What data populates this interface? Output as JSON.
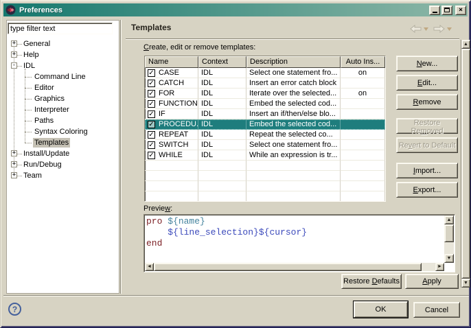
{
  "window": {
    "title": "Preferences",
    "controls": {
      "minimize": "minimize",
      "maximize": "maximize",
      "close": "close"
    }
  },
  "sidebar": {
    "filter_text": "type filter text",
    "tree": [
      {
        "label": "General",
        "level": 0,
        "expander": "+",
        "selected": false
      },
      {
        "label": "Help",
        "level": 0,
        "expander": "+",
        "selected": false
      },
      {
        "label": "IDL",
        "level": 0,
        "expander": "-",
        "selected": false
      },
      {
        "label": "Command Line",
        "level": 1,
        "expander": "",
        "selected": false
      },
      {
        "label": "Editor",
        "level": 1,
        "expander": "",
        "selected": false
      },
      {
        "label": "Graphics",
        "level": 1,
        "expander": "",
        "selected": false
      },
      {
        "label": "Interpreter",
        "level": 1,
        "expander": "",
        "selected": false
      },
      {
        "label": "Paths",
        "level": 1,
        "expander": "",
        "selected": false
      },
      {
        "label": "Syntax Coloring",
        "level": 1,
        "expander": "",
        "selected": false
      },
      {
        "label": "Templates",
        "level": 1,
        "expander": "",
        "selected": true
      },
      {
        "label": "Install/Update",
        "level": 0,
        "expander": "+",
        "selected": false
      },
      {
        "label": "Run/Debug",
        "level": 0,
        "expander": "+",
        "selected": false
      },
      {
        "label": "Team",
        "level": 0,
        "expander": "+",
        "selected": false
      }
    ]
  },
  "content": {
    "page_title": "Templates",
    "table_label": {
      "label": "Create, edit or remove templates:",
      "mnemonic": "C"
    },
    "table": {
      "columns": [
        "Name",
        "Context",
        "Description",
        "Auto Ins..."
      ],
      "rows": [
        {
          "checked": true,
          "name": "CASE",
          "context": "IDL",
          "description": "Select one statement fro...",
          "auto_insert": "on",
          "selected": false
        },
        {
          "checked": true,
          "name": "CATCH",
          "context": "IDL",
          "description": "Insert an error catch block",
          "auto_insert": "",
          "selected": false
        },
        {
          "checked": true,
          "name": "FOR",
          "context": "IDL",
          "description": "Iterate over the selected...",
          "auto_insert": "on",
          "selected": false
        },
        {
          "checked": true,
          "name": "FUNCTION",
          "context": "IDL",
          "description": "Embed the selected cod...",
          "auto_insert": "",
          "selected": false
        },
        {
          "checked": true,
          "name": "IF",
          "context": "IDL",
          "description": "Insert an if/then/else blo...",
          "auto_insert": "",
          "selected": false
        },
        {
          "checked": true,
          "name": "PROCEDU...",
          "context": "IDL",
          "description": "Embed the selected cod...",
          "auto_insert": "",
          "selected": true
        },
        {
          "checked": true,
          "name": "REPEAT",
          "context": "IDL",
          "description": "Repeat the selected co...",
          "auto_insert": "",
          "selected": false
        },
        {
          "checked": true,
          "name": "SWITCH",
          "context": "IDL",
          "description": "Select one statement fro...",
          "auto_insert": "",
          "selected": false
        },
        {
          "checked": true,
          "name": "WHILE",
          "context": "IDL",
          "description": "While an expression is tr...",
          "auto_insert": "",
          "selected": false
        }
      ]
    },
    "side_buttons": [
      {
        "label": "New...",
        "mnemonic": "N",
        "enabled": true
      },
      {
        "label": "Edit...",
        "mnemonic": "E",
        "enabled": true
      },
      {
        "label": "Remove",
        "mnemonic": "R",
        "enabled": true
      },
      {
        "label": "Restore Removed",
        "mnemonic": "m",
        "enabled": false
      },
      {
        "label": "Revert to Default",
        "mnemonic": "v",
        "enabled": false
      },
      {
        "label": "Import...",
        "mnemonic": "I",
        "enabled": true
      },
      {
        "label": "Export...",
        "mnemonic": "E",
        "enabled": true
      }
    ],
    "preview": {
      "label": {
        "label": "Preview:",
        "mnemonic": "w"
      },
      "code_lines": [
        [
          {
            "text": "pro ",
            "style": "keyword"
          },
          {
            "text": "${name}",
            "style": "variable_teal"
          }
        ],
        [
          {
            "text": "    ",
            "style": "plain"
          },
          {
            "text": "${line_selection}",
            "style": "variable_blue"
          },
          {
            "text": "${cursor}",
            "style": "variable_blue"
          }
        ],
        [
          {
            "text": "end",
            "style": "keyword"
          }
        ]
      ]
    },
    "footer_buttons": {
      "restore_defaults": {
        "label": "Restore Defaults",
        "mnemonic": "D"
      },
      "apply": {
        "label": "Apply",
        "mnemonic": "A"
      }
    }
  },
  "dialog_buttons": {
    "ok": "OK",
    "cancel": "Cancel",
    "help": "?"
  },
  "colors": {
    "titlebar_start": "#15786e",
    "titlebar_end": "#8fb8a8",
    "selection": "#1e7d7d",
    "background": "#d7d3c3",
    "code": {
      "keyword": "#7c1f24",
      "variable_teal": "#44839e",
      "variable_blue": "#3b49bb",
      "plain": "#000000"
    }
  }
}
